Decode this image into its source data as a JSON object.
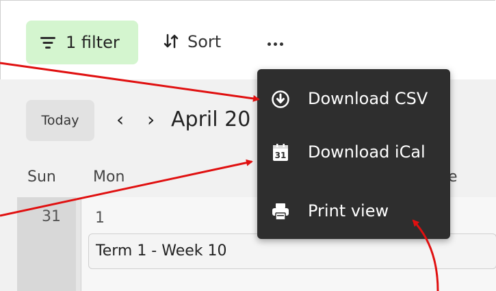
{
  "toolbar": {
    "filter_label": "1 filter",
    "sort_label": "Sort",
    "more_icon": "ellipsis-icon"
  },
  "calendar": {
    "today_label": "Today",
    "prev_icon": "‹",
    "next_icon": "›",
    "month_title": "April 20",
    "days": {
      "sun": "Sun",
      "mon": "Mon",
      "tue_partial": "e"
    },
    "cells": {
      "sun_date": "31",
      "mon_date": "1"
    },
    "event": "Term 1 - Week 10"
  },
  "menu": {
    "items": [
      {
        "label": "Download CSV",
        "icon": "download-circle-icon"
      },
      {
        "label": "Download iCal",
        "icon": "calendar-31-icon"
      },
      {
        "label": "Print view",
        "icon": "printer-icon"
      }
    ]
  },
  "annotation": {
    "arrow_color": "#e01010"
  },
  "colors": {
    "filter_bg": "#d4f5cf",
    "menu_bg": "#2e2e2e"
  }
}
